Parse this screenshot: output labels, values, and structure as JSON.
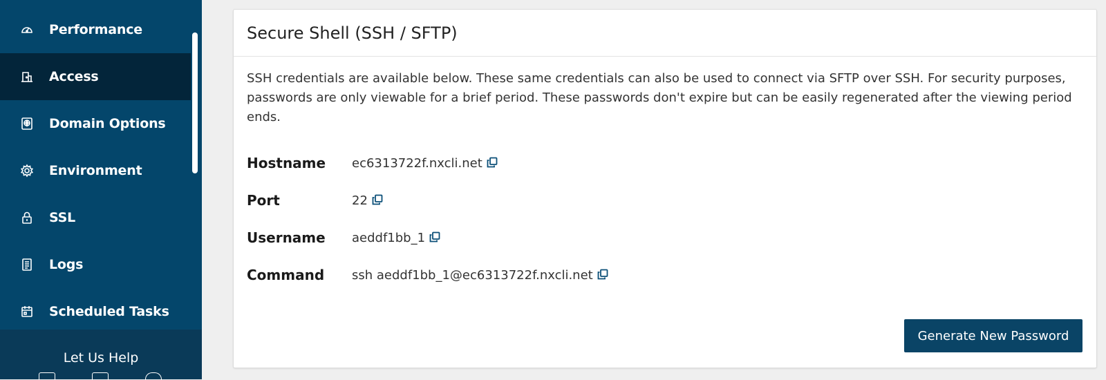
{
  "sidebar": {
    "items": [
      {
        "label": "Performance",
        "icon": "gauge-icon",
        "active": false
      },
      {
        "label": "Access",
        "icon": "access-icon",
        "active": true
      },
      {
        "label": "Domain Options",
        "icon": "globe-icon",
        "active": false
      },
      {
        "label": "Environment",
        "icon": "gear-icon",
        "active": false
      },
      {
        "label": "SSL",
        "icon": "lock-icon",
        "active": false
      },
      {
        "label": "Logs",
        "icon": "document-icon",
        "active": false
      },
      {
        "label": "Scheduled Tasks",
        "icon": "calendar-icon",
        "active": false
      }
    ],
    "help_label": "Let Us Help"
  },
  "card": {
    "title": "Secure Shell (SSH / SFTP)",
    "description": "SSH credentials are available below. These same credentials can also be used to connect via SFTP over SSH. For security purposes, passwords are only viewable for a brief period. These passwords don't expire but can be easily regenerated after the viewing period ends.",
    "fields": [
      {
        "label": "Hostname",
        "value": "ec6313722f.nxcli.net"
      },
      {
        "label": "Port",
        "value": "22"
      },
      {
        "label": "Username",
        "value": "aeddf1bb_1"
      },
      {
        "label": "Command",
        "value": "ssh aeddf1bb_1@ec6313722f.nxcli.net"
      }
    ],
    "button_label": "Generate New Password"
  },
  "colors": {
    "sidebar_bg": "#04466b",
    "sidebar_active": "#03253a",
    "button_bg": "#0a4466",
    "copy_icon": "#0b4f78"
  }
}
